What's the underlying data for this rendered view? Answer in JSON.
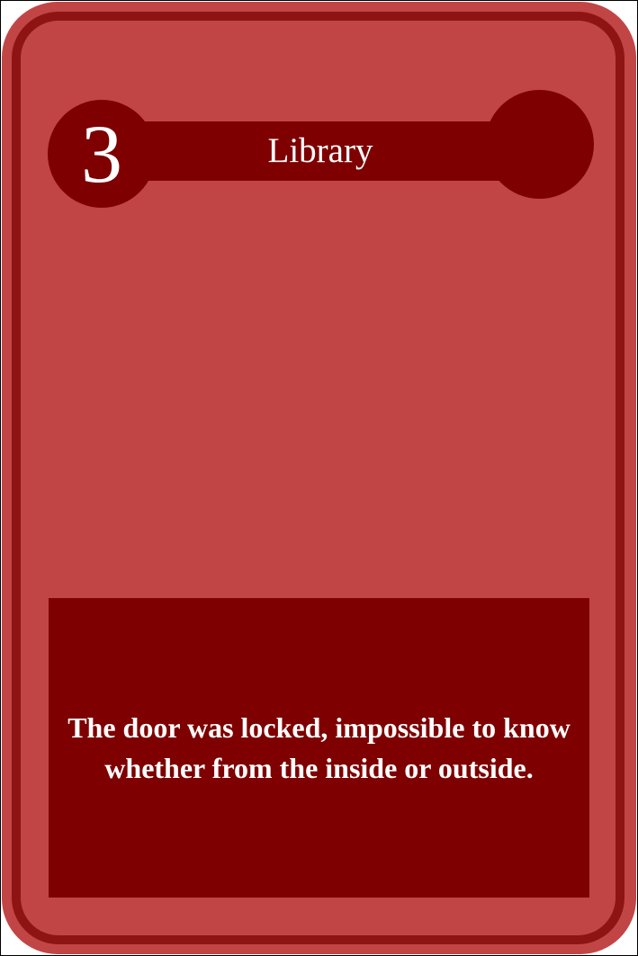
{
  "card": {
    "number": "3",
    "title": "Library",
    "text": "The door was locked, impossible to know whether from the inside or outside."
  },
  "colors": {
    "card_background": "#c24545",
    "frame": "#8e1414",
    "panel": "#7e0000",
    "text": "#ffffff"
  }
}
